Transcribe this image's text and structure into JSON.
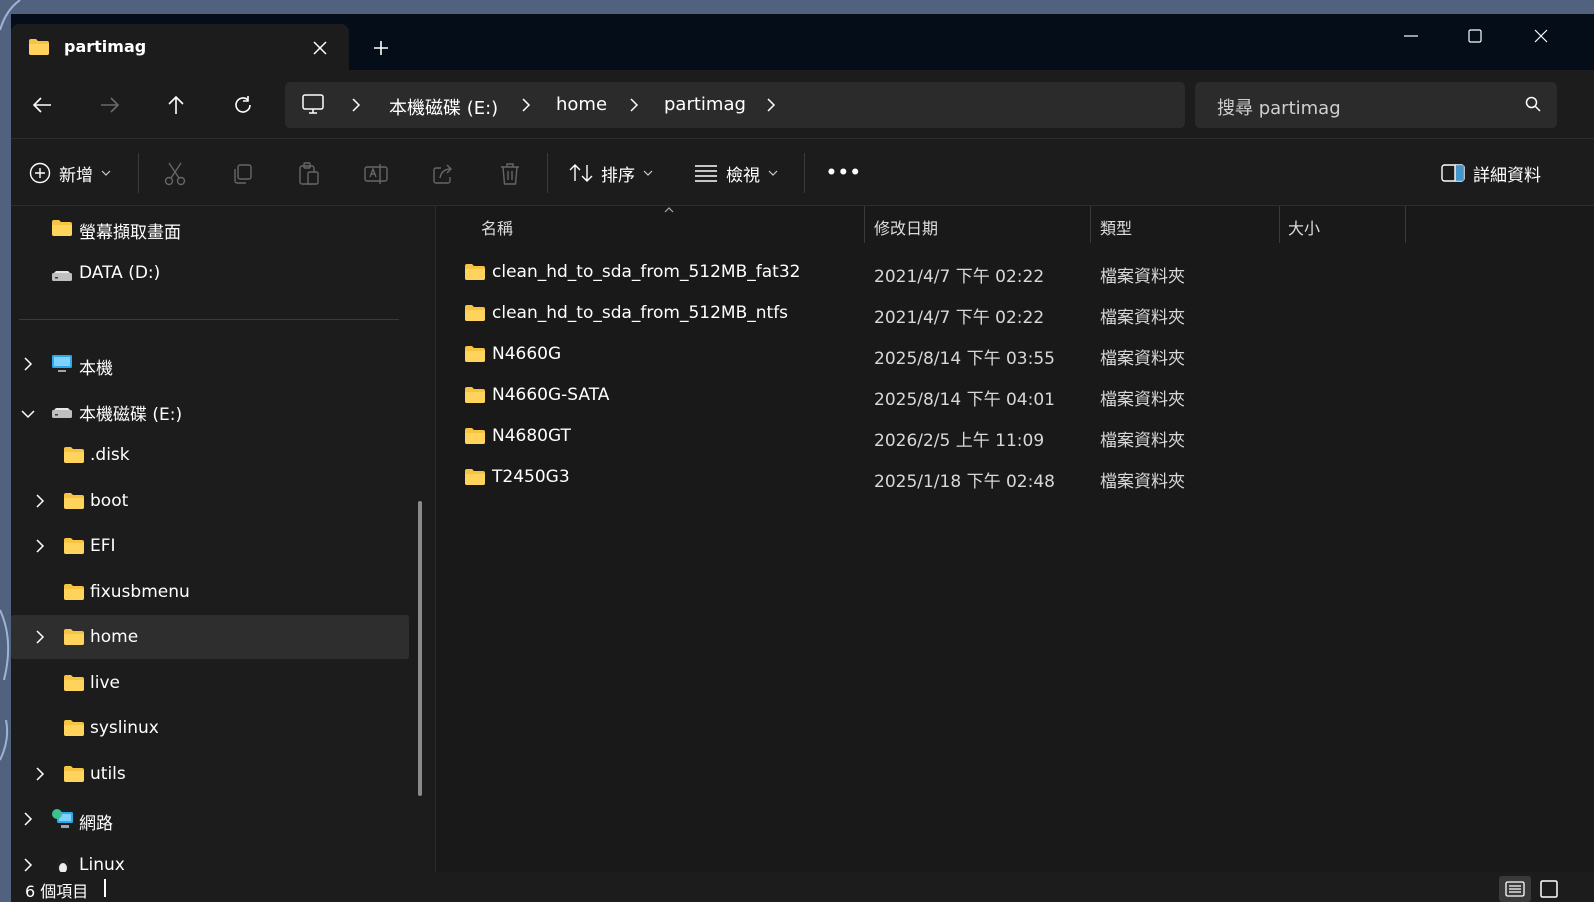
{
  "window": {
    "tab_title": "partimag",
    "icons": {
      "folder": "folder-icon",
      "close": "close-icon",
      "new_tab": "plus-icon",
      "minimize": "minimize-icon",
      "maximize": "maximize-icon",
      "window_close": "close-icon"
    }
  },
  "address": {
    "breadcrumbs": [
      "本機磁碟 (E:)",
      "home",
      "partimag"
    ],
    "search_placeholder": "搜尋 partimag"
  },
  "toolbar": {
    "new_label": "新增",
    "sort_label": "排序",
    "view_label": "檢視",
    "details_label": "詳細資料",
    "more_label": "•••"
  },
  "navpane": {
    "items": [
      {
        "label": "螢幕擷取畫面",
        "icon": "folder-icon"
      },
      {
        "label": "DATA (D:)",
        "icon": "drive-icon"
      },
      {
        "label": "本機",
        "icon": "pc-icon"
      },
      {
        "label": "本機磁碟 (E:)",
        "icon": "drive-icon"
      },
      {
        "label": ".disk",
        "icon": "folder-icon"
      },
      {
        "label": "boot",
        "icon": "folder-icon"
      },
      {
        "label": "EFI",
        "icon": "folder-icon"
      },
      {
        "label": "fixusbmenu",
        "icon": "folder-icon"
      },
      {
        "label": "home",
        "icon": "folder-icon"
      },
      {
        "label": "live",
        "icon": "folder-icon"
      },
      {
        "label": "syslinux",
        "icon": "folder-icon"
      },
      {
        "label": "utils",
        "icon": "folder-icon"
      },
      {
        "label": "網路",
        "icon": "network-icon"
      },
      {
        "label": "Linux",
        "icon": "linux-icon"
      }
    ]
  },
  "columns": {
    "name": "名稱",
    "date": "修改日期",
    "type": "類型",
    "size": "大小"
  },
  "files": [
    {
      "name": "clean_hd_to_sda_from_512MB_fat32",
      "date": "2021/4/7 下午 02:22",
      "type": "檔案資料夾",
      "size": ""
    },
    {
      "name": "clean_hd_to_sda_from_512MB_ntfs",
      "date": "2021/4/7 下午 02:22",
      "type": "檔案資料夾",
      "size": ""
    },
    {
      "name": "N4660G",
      "date": "2025/8/14 下午 03:55",
      "type": "檔案資料夾",
      "size": ""
    },
    {
      "name": "N4660G-SATA",
      "date": "2025/8/14 下午 04:01",
      "type": "檔案資料夾",
      "size": ""
    },
    {
      "name": "N4680GT",
      "date": "2026/2/5 上午 11:09",
      "type": "檔案資料夾",
      "size": ""
    },
    {
      "name": "T2450G3",
      "date": "2025/1/18 下午 02:48",
      "type": "檔案資料夾",
      "size": ""
    }
  ],
  "status": {
    "item_count": "6 個項目"
  },
  "colors": {
    "folder": "#f6c343",
    "accent": "#4aa3df",
    "background": "#1c1c1c"
  }
}
